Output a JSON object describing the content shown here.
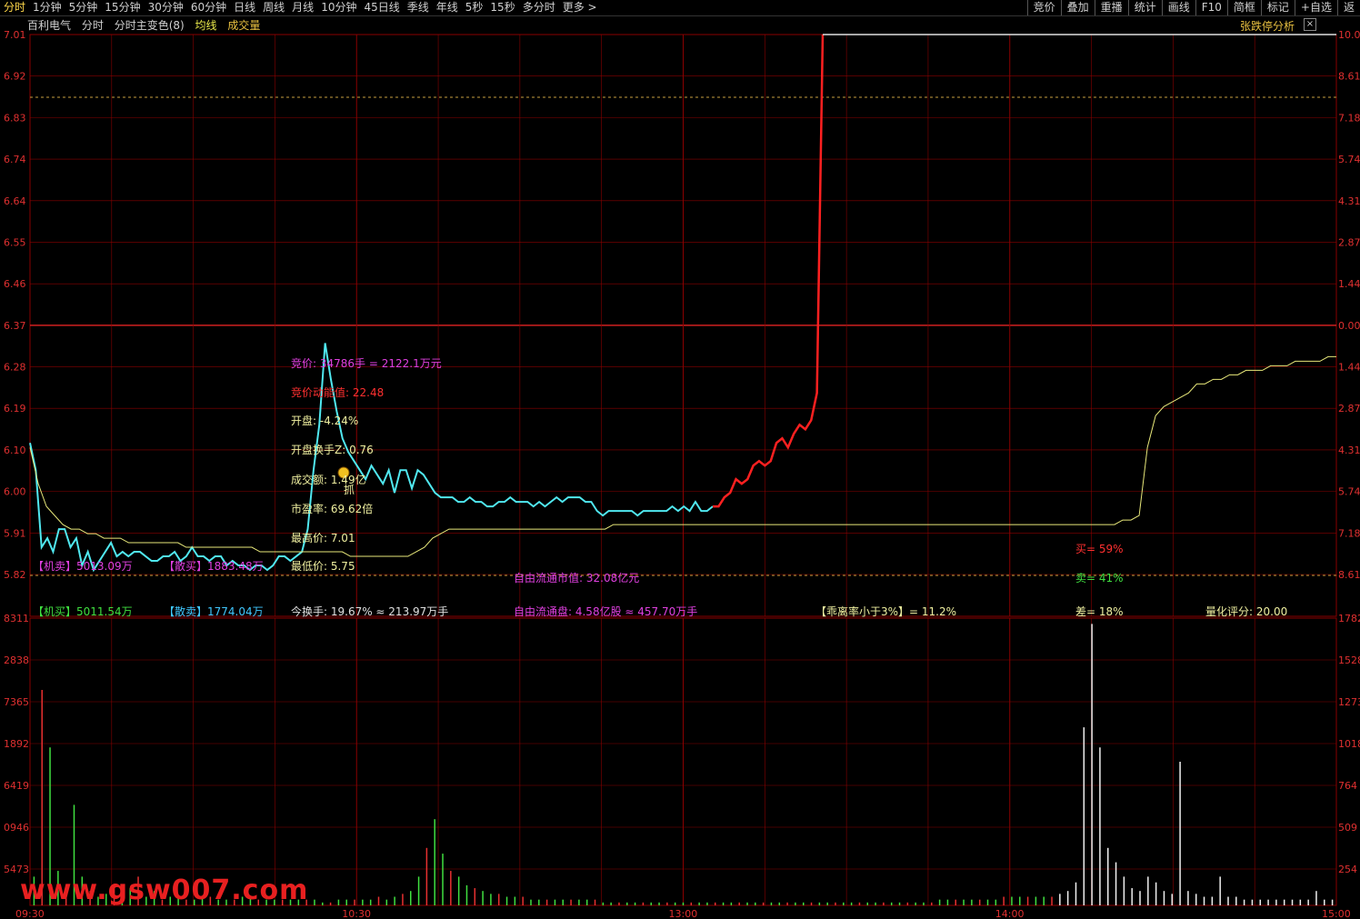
{
  "toolbar": {
    "periods": [
      "分时",
      "1分钟",
      "5分钟",
      "15分钟",
      "30分钟",
      "60分钟",
      "日线",
      "周线",
      "月线",
      "10分钟",
      "45日线",
      "季线",
      "年线",
      "5秒",
      "15秒",
      "多分时",
      "更多 >"
    ],
    "active_index": 0,
    "right_items": [
      "竞价",
      "叠加",
      "重播",
      "统计",
      "画线",
      "F10",
      "简框",
      "标记",
      "+自选",
      "返"
    ]
  },
  "header": {
    "stock_name": "百利电气",
    "mode": "分时",
    "indicator": "分时主变色(8)",
    "avg_label": "均线",
    "vol_label": "成交量",
    "limit_analysis": "张跌停分析",
    "close_icon_glyph": "×"
  },
  "colors": {
    "grid": "#8a0000",
    "price_line_up": "#50e8f0",
    "price_line_red": "#ff2020",
    "avg_line": "#e8e87a",
    "axis_text": "#e03030",
    "dashed": "#c8a040"
  },
  "price_axis": {
    "left_ticks": [
      "7.01",
      "6.92",
      "6.83",
      "6.74",
      "6.64",
      "6.55",
      "6.46",
      "6.37",
      "6.28",
      "6.19",
      "6.10",
      "6.00",
      "5.91",
      "5.82"
    ],
    "right_ticks": [
      "10.0",
      "8.61",
      "7.18",
      "5.74",
      "4.31",
      "2.87",
      "1.44",
      "0.00",
      "1.44",
      "2.87",
      "4.31",
      "5.74",
      "7.18",
      "8.61"
    ],
    "min": 5.82,
    "max": 7.01,
    "prev_close": 6.37
  },
  "volume_axis": {
    "left_ticks": [
      "8311",
      "2838",
      "7365",
      "1892",
      "6419",
      "0946",
      "5473"
    ],
    "right_ticks": [
      "1782",
      "1528",
      "1273",
      "1018",
      "764",
      "509",
      "254"
    ]
  },
  "time_axis": {
    "labels": [
      "09:30",
      "10:30",
      "13:00",
      "14:00",
      "15:00"
    ]
  },
  "chart_data": {
    "type": "line",
    "series": [
      {
        "y": [
          6.11,
          6.05,
          5.88,
          5.9,
          5.87,
          5.92,
          5.92,
          5.88,
          5.9,
          5.84,
          5.87,
          5.83,
          5.85,
          5.87,
          5.89,
          5.86,
          5.87,
          5.86,
          5.87,
          5.87,
          5.86,
          5.85,
          5.85,
          5.86,
          5.86,
          5.87,
          5.85,
          5.86,
          5.88,
          5.86,
          5.86,
          5.85,
          5.86,
          5.86,
          5.84,
          5.85,
          5.84,
          5.84,
          5.83,
          5.84,
          5.84,
          5.83,
          5.84,
          5.86,
          5.86,
          5.85,
          5.86,
          5.87,
          5.92,
          6.05,
          6.15,
          6.33,
          6.25,
          6.18,
          6.12,
          6.09,
          6.07,
          6.05,
          6.03,
          6.06,
          6.04,
          6.02,
          6.05,
          6.0,
          6.05,
          6.05,
          6.01,
          6.05,
          6.04,
          6.02,
          6.0,
          5.99,
          5.99,
          5.99,
          5.98,
          5.98,
          5.99,
          5.98,
          5.98,
          5.97,
          5.97,
          5.98,
          5.98,
          5.99,
          5.98,
          5.98,
          5.98,
          5.97,
          5.98,
          5.97,
          5.98,
          5.99,
          5.98,
          5.99,
          5.99,
          5.99,
          5.98,
          5.98,
          5.96,
          5.95,
          5.96,
          5.96,
          5.96,
          5.96,
          5.96,
          5.95,
          5.96,
          5.96,
          5.96,
          5.96,
          5.96,
          5.97,
          5.96,
          5.97,
          5.96,
          5.98,
          5.96,
          5.96,
          5.97,
          5.97,
          5.99,
          6.0,
          6.03,
          6.02,
          6.03,
          6.06,
          6.07,
          6.06,
          6.07,
          6.11,
          6.12,
          6.1,
          6.13,
          6.15,
          6.14,
          6.16,
          6.22,
          7.01
        ]
      },
      {
        "y": [
          6.1,
          6.02,
          5.97,
          5.95,
          5.93,
          5.92,
          5.92,
          5.91,
          5.91,
          5.9,
          5.9,
          5.9,
          5.89,
          5.89,
          5.89,
          5.89,
          5.89,
          5.89,
          5.89,
          5.88,
          5.88,
          5.88,
          5.88,
          5.88,
          5.88,
          5.88,
          5.88,
          5.88,
          5.87,
          5.87,
          5.87,
          5.87,
          5.87,
          5.87,
          5.87,
          5.87,
          5.87,
          5.87,
          5.87,
          5.86,
          5.86,
          5.86,
          5.86,
          5.86,
          5.86,
          5.86,
          5.86,
          5.87,
          5.88,
          5.9,
          5.91,
          5.92,
          5.92,
          5.92,
          5.92,
          5.92,
          5.92,
          5.92,
          5.92,
          5.92,
          5.92,
          5.92,
          5.92,
          5.92,
          5.92,
          5.92,
          5.92,
          5.92,
          5.92,
          5.92,
          5.92,
          5.93,
          5.93,
          5.93,
          5.93,
          5.93,
          5.93,
          5.93,
          5.93,
          5.93,
          5.93,
          5.93,
          5.93,
          5.93,
          5.93,
          5.93,
          5.93,
          5.93,
          5.93,
          5.93,
          5.93,
          5.93,
          5.93,
          5.93,
          5.93,
          5.93,
          5.93,
          5.93,
          5.93,
          5.93,
          5.93,
          5.93,
          5.93,
          5.93,
          5.93,
          5.93,
          5.93,
          5.93,
          5.93,
          5.93,
          5.93,
          5.93,
          5.93,
          5.93,
          5.93,
          5.93,
          5.93,
          5.93,
          5.93,
          5.93,
          5.93,
          5.93,
          5.93,
          5.93,
          5.93,
          5.93,
          5.93,
          5.93,
          5.93,
          5.93,
          5.93,
          5.93,
          5.93,
          5.94,
          5.94,
          5.95,
          6.1,
          6.17,
          6.19,
          6.2,
          6.21,
          6.22,
          6.24,
          6.24,
          6.25,
          6.25,
          6.26,
          6.26,
          6.27,
          6.27,
          6.27,
          6.28,
          6.28,
          6.28,
          6.29,
          6.29,
          6.29,
          6.29,
          6.3,
          6.3
        ]
      }
    ],
    "volumes": [
      0.1,
      0.75,
      0.55,
      0.12,
      0.05,
      0.35,
      0.1,
      0.05,
      0.03,
      0.04,
      0.07,
      0.03,
      0.06,
      0.1,
      0.03,
      0.05,
      0.02,
      0.03,
      0.03,
      0.02,
      0.02,
      0.03,
      0.03,
      0.02,
      0.02,
      0.02,
      0.03,
      0.03,
      0.02,
      0.02,
      0.02,
      0.02,
      0.02,
      0.02,
      0.02,
      0.02,
      0.01,
      0.01,
      0.02,
      0.02,
      0.02,
      0.02,
      0.02,
      0.03,
      0.02,
      0.03,
      0.04,
      0.05,
      0.1,
      0.2,
      0.3,
      0.18,
      0.12,
      0.1,
      0.07,
      0.06,
      0.05,
      0.04,
      0.04,
      0.03,
      0.03,
      0.03,
      0.02,
      0.02,
      0.02,
      0.02,
      0.02,
      0.02,
      0.02,
      0.02,
      0.02,
      0.01,
      0.01,
      0.01,
      0.01,
      0.01,
      0.01,
      0.01,
      0.01,
      0.01,
      0.01,
      0.01,
      0.01,
      0.01,
      0.01,
      0.01,
      0.01,
      0.01,
      0.01,
      0.01,
      0.01,
      0.01,
      0.01,
      0.01,
      0.01,
      0.01,
      0.01,
      0.01,
      0.01,
      0.01,
      0.01,
      0.01,
      0.01,
      0.01,
      0.01,
      0.01,
      0.01,
      0.01,
      0.01,
      0.01,
      0.01,
      0.01,
      0.01,
      0.02,
      0.02,
      0.02,
      0.02,
      0.02,
      0.02,
      0.02,
      0.02,
      0.03,
      0.03,
      0.03,
      0.03,
      0.03,
      0.03,
      0.03,
      0.04,
      0.05,
      0.08,
      0.62,
      0.98,
      0.55,
      0.2,
      0.15,
      0.1,
      0.06,
      0.05,
      0.1,
      0.08,
      0.05,
      0.04,
      0.5,
      0.05,
      0.04,
      0.03,
      0.03,
      0.1,
      0.03,
      0.03,
      0.02,
      0.02,
      0.02,
      0.02,
      0.02,
      0.02,
      0.02,
      0.02,
      0.02,
      0.05,
      0.02,
      0.02
    ]
  },
  "overlay": {
    "auction": "竞价: 34786手 = 2122.1万元",
    "auction_energy": "竞价动能值: 22.48",
    "open": "开盘: -4.24%",
    "open_turnover": "开盘换手Z: 0.76",
    "turnover_amount": "成交额: 1.49亿",
    "grab": "抓",
    "pe": "市盈率: 69.62倍",
    "high": "最高价: 7.01",
    "low": "最低价: 5.75",
    "inst_sell": "【机卖】5013.09万",
    "retail_buy": "【散买】1883.48万",
    "inst_buy": "【机买】5011.54万",
    "retail_sell": "【散卖】1774.04万",
    "turnover_today": "今换手: 19.67% ≈ 213.97万手",
    "float_mcap": "自由流通市值: 32.08亿元",
    "float_shares": "自由流通盘: 4.58亿股 ≈ 457.70万手",
    "deviation": "【乖离率小于3%】= 11.2%",
    "buy_ratio": "买= 59%",
    "sell_ratio": "卖= 41%",
    "diff": "差= 18%",
    "quant_score": "量化评分: 20.00"
  },
  "watermark": "www.gsw007.com"
}
